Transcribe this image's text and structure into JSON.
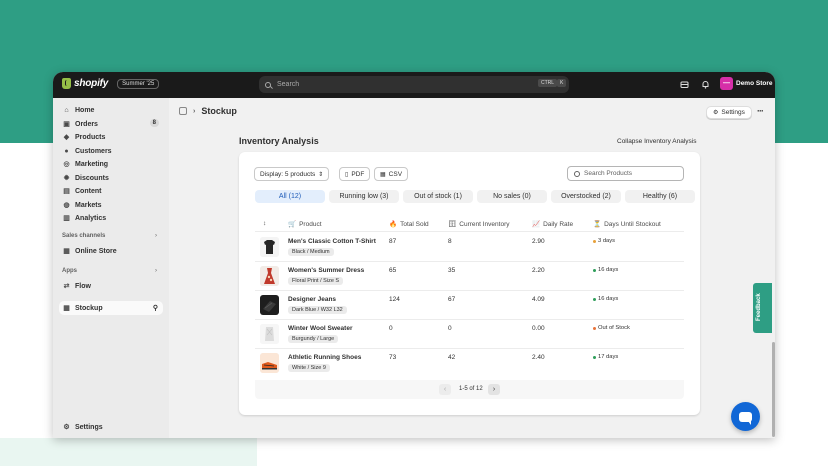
{
  "topbar": {
    "brand": "shopify",
    "season_badge": "Summer '25",
    "search_placeholder": "Search",
    "shortcut_ctrl": "CTRL",
    "shortcut_key": "K",
    "store_initial": "—",
    "store_name": "Demo Store"
  },
  "sidebar": {
    "items": [
      {
        "label": "Home",
        "icon": "home-icon"
      },
      {
        "label": "Orders",
        "icon": "orders-icon",
        "count": "8"
      },
      {
        "label": "Products",
        "icon": "tag-icon"
      },
      {
        "label": "Customers",
        "icon": "person-icon"
      },
      {
        "label": "Marketing",
        "icon": "target-icon"
      },
      {
        "label": "Discounts",
        "icon": "discount-icon"
      },
      {
        "label": "Content",
        "icon": "content-icon"
      },
      {
        "label": "Markets",
        "icon": "globe-icon"
      },
      {
        "label": "Analytics",
        "icon": "chart-icon"
      }
    ],
    "sales_channels_label": "Sales channels",
    "online_store": "Online Store",
    "apps_label": "Apps",
    "flow": "Flow",
    "stockup": "Stockup",
    "settings": "Settings"
  },
  "page": {
    "title": "Stockup",
    "settings_button": "Settings",
    "more": "···"
  },
  "analysis": {
    "title": "Inventory Analysis",
    "collapse_link": "Collapse Inventory Analysis",
    "display_select": "Display: 5 products",
    "pdf_button": "PDF",
    "csv_button": "CSV",
    "search_placeholder": "Search Products",
    "tabs": [
      "All (12)",
      "Running low (3)",
      "Out of stock (1)",
      "No sales (0)",
      "Overstocked (2)",
      "Healthy (6)"
    ],
    "columns": {
      "sort": "↕",
      "product": "Product",
      "total_sold": "Total Sold",
      "current_inventory": "Current Inventory",
      "daily_rate": "Daily Rate",
      "days_until_stockout": "Days Until Stockout"
    },
    "rows": [
      {
        "name": "Men's Classic Cotton T-Shirt",
        "variant": "Black / Medium",
        "sold": "87",
        "inventory": "8",
        "rate": "2.90",
        "days": "3 days",
        "status_color": "#e8a13a"
      },
      {
        "name": "Women's Summer Dress",
        "variant": "Floral Print / Size S",
        "sold": "65",
        "inventory": "35",
        "rate": "2.20",
        "days": "16 days",
        "status_color": "#2e9e5a"
      },
      {
        "name": "Designer Jeans",
        "variant": "Dark Blue / W32 L32",
        "sold": "124",
        "inventory": "67",
        "rate": "4.09",
        "days": "16 days",
        "status_color": "#2e9e5a"
      },
      {
        "name": "Winter Wool Sweater",
        "variant": "Burgundy / Large",
        "sold": "0",
        "inventory": "0",
        "rate": "0.00",
        "days": "Out of Stock",
        "status_color": "#e8733a"
      },
      {
        "name": "Athletic Running Shoes",
        "variant": "White / Size 9",
        "sold": "73",
        "inventory": "42",
        "rate": "2.40",
        "days": "17 days",
        "status_color": "#2e9e5a"
      }
    ],
    "pagination": "1-5 of 12"
  },
  "feedback_tab": "Feedback"
}
